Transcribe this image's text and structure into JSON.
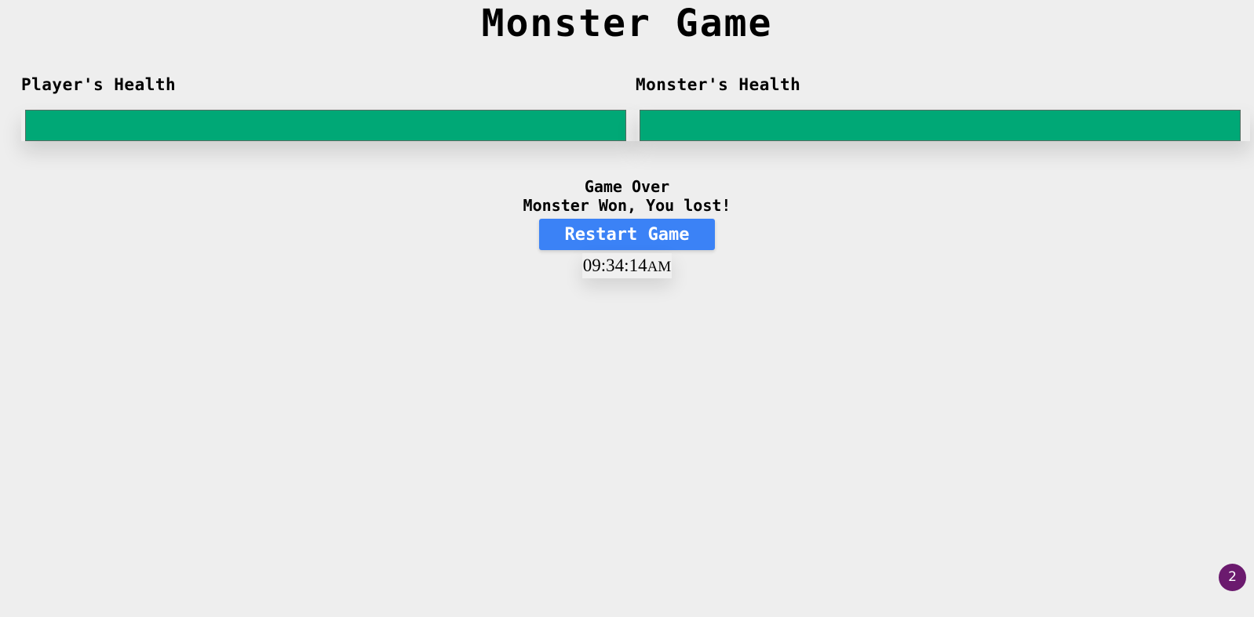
{
  "title": "Monster Game",
  "player": {
    "label": "Player's Health",
    "health_percent": 100,
    "bar_color": "#00a876"
  },
  "monster": {
    "label": "Monster's Health",
    "health_percent": 100,
    "bar_color": "#00a876"
  },
  "game_over": {
    "title": "Game Over",
    "message": "Monster Won, You lost!"
  },
  "restart_button": {
    "label": "Restart Game",
    "color": "#3b82f6"
  },
  "clock": {
    "time": "09:34:14",
    "ampm": "AM"
  },
  "notification_badge": {
    "count": "2",
    "color": "#6b1a6e"
  }
}
